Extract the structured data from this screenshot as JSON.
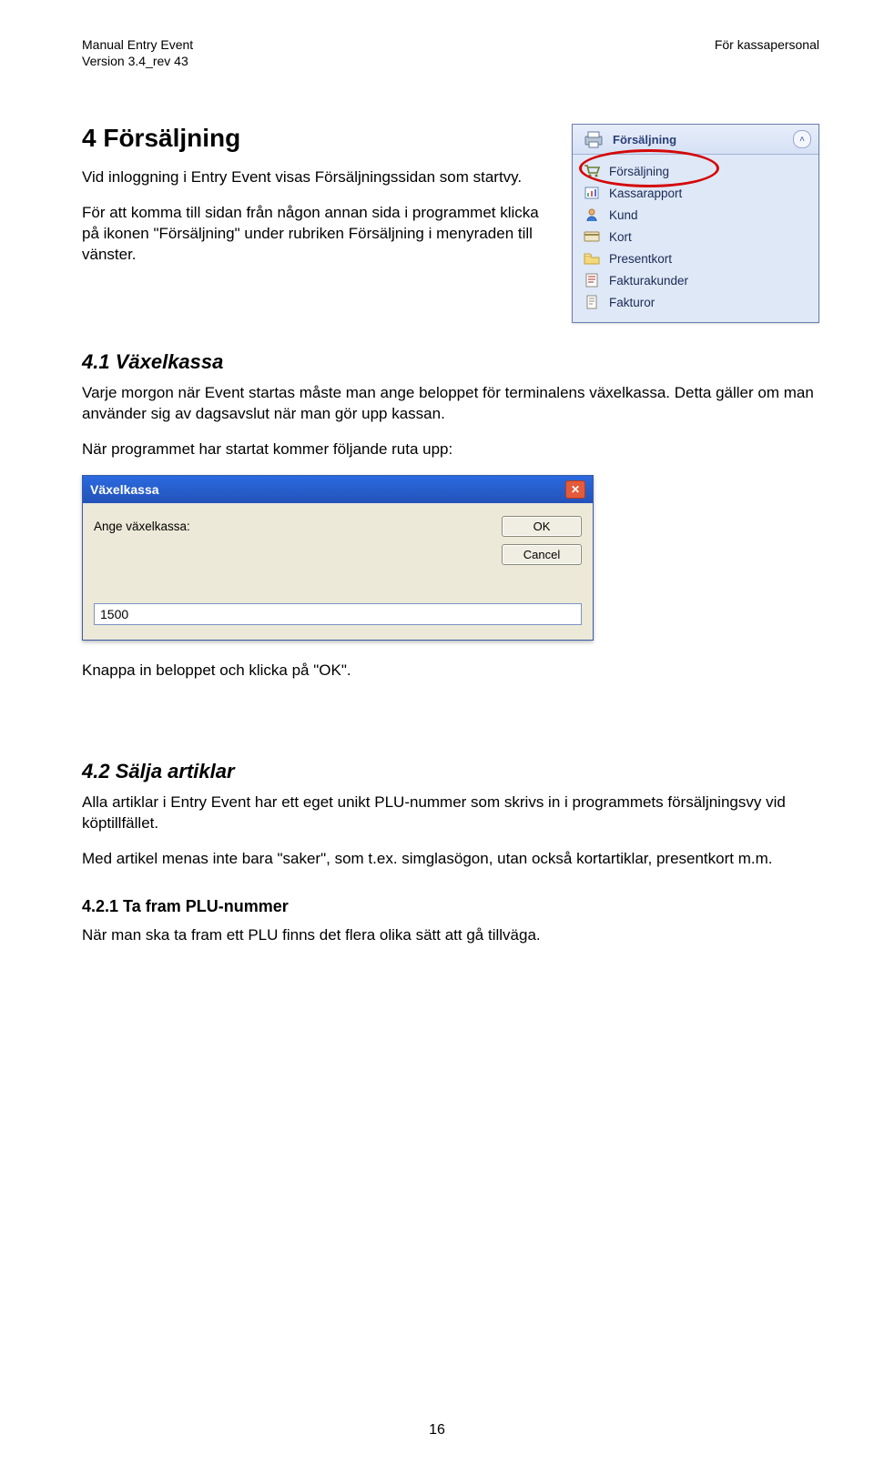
{
  "header": {
    "left1": "Manual Entry Event",
    "left2": "Version 3.4_rev 43",
    "right": "För kassapersonal"
  },
  "h1": "4  Försäljning",
  "intro1": "Vid inloggning i Entry Event visas Försäljningssidan som startvy.",
  "intro2": "För att komma till sidan från någon annan sida i programmet klicka på ikonen \"Försäljning\" under rubriken Försäljning i menyraden till vänster.",
  "sidebar": {
    "title": "Försäljning",
    "items": [
      {
        "icon": "cart-icon",
        "label": "Försäljning"
      },
      {
        "icon": "report-icon",
        "label": "Kassarapport"
      },
      {
        "icon": "person-icon",
        "label": "Kund"
      },
      {
        "icon": "card-icon",
        "label": "Kort"
      },
      {
        "icon": "folder-icon",
        "label": "Presentkort"
      },
      {
        "icon": "invoice-icon",
        "label": "Fakturakunder"
      },
      {
        "icon": "page-icon",
        "label": "Fakturor"
      }
    ]
  },
  "h2_41": "4.1    Växelkassa",
  "p_41a": "Varje morgon när Event startas måste man ange beloppet för terminalens växelkassa. Detta gäller om man använder sig av dagsavslut när man gör upp kassan.",
  "p_41b": "När programmet har startat kommer följande ruta upp:",
  "dialog": {
    "title": "Växelkassa",
    "label": "Ange växelkassa:",
    "ok": "OK",
    "cancel": "Cancel",
    "value": "1500"
  },
  "p_41c": "Knappa in beloppet och klicka på \"OK\".",
  "h2_42": "4.2    Sälja artiklar",
  "p_42a": "Alla artiklar i Entry Event har ett eget unikt PLU-nummer som skrivs in i programmets försäljningsvy vid köptillfället.",
  "p_42b": "Med artikel menas inte bara \"saker\", som t.ex. simglasögon, utan också kortartiklar, presentkort m.m.",
  "h3_421": "4.2.1  Ta fram PLU-nummer",
  "p_421": "När man ska ta fram ett PLU finns det flera olika sätt att gå tillväga.",
  "pagenum": "16"
}
